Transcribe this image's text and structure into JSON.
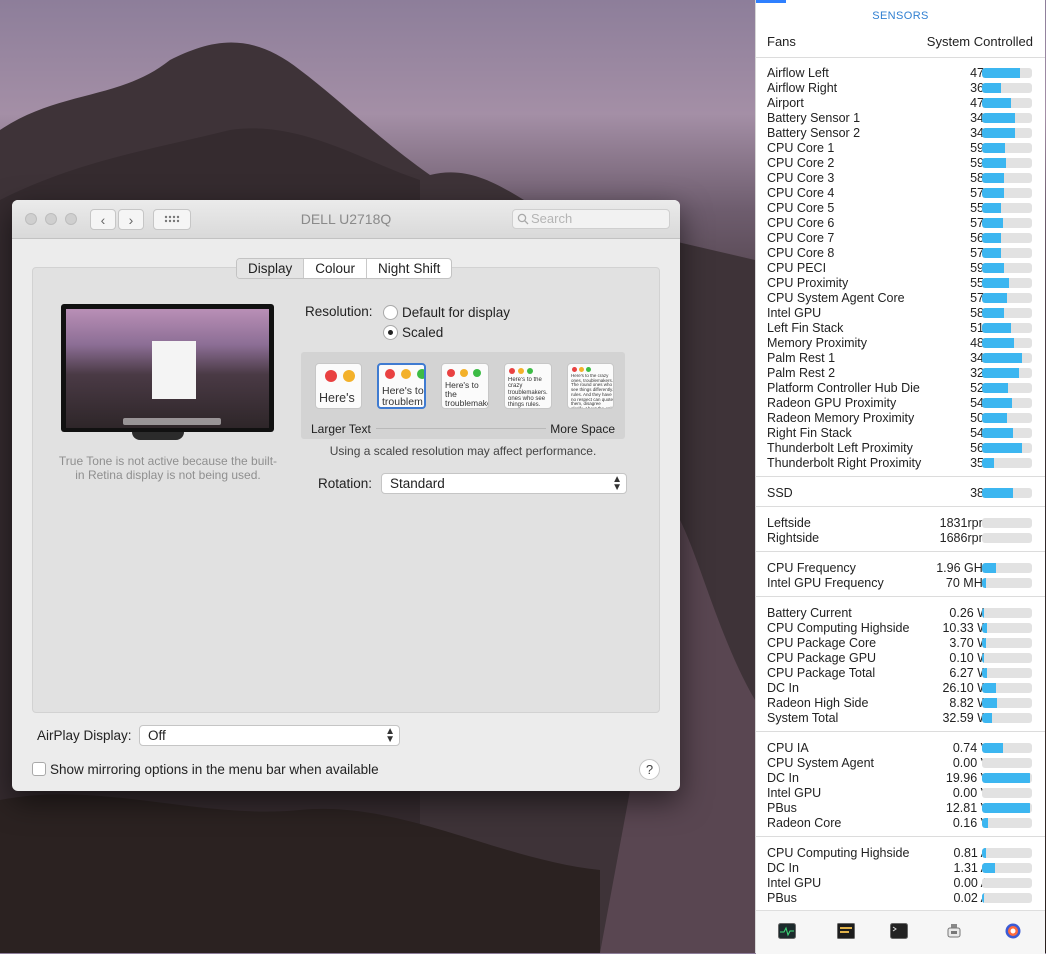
{
  "window": {
    "title": "DELL U2718Q",
    "search_placeholder": "Search",
    "tabs": [
      "Display",
      "Colour",
      "Night Shift"
    ],
    "true_tone_note": "True Tone is not active because the built-in Retina display is not being used.",
    "resolution_label": "Resolution:",
    "resolution_options": [
      "Default for display",
      "Scaled"
    ],
    "resolution_selected": "Scaled",
    "thumb_texts": [
      "Here's",
      "Here's to troublem",
      "Here's to the troublemakers. ones who see",
      "Here's to the crazy troublemakers. ones who see things rules. And they",
      "Here's to the crazy ones, troublemakers. The round ones who see things differently. rules. And they have no respect can quote them, disagree glorify. About the only thing because they change things."
    ],
    "scale_left_label": "Larger Text",
    "scale_right_label": "More Space",
    "perf_note": "Using a scaled resolution may affect performance.",
    "rotation_label": "Rotation:",
    "rotation_value": "Standard",
    "airplay_label": "AirPlay Display:",
    "airplay_value": "Off",
    "mirroring_label": "Show mirroring options in the menu bar when available",
    "help_label": "?"
  },
  "sensors": {
    "title": "SENSORS",
    "fans_label": "Fans",
    "fans_value": "System Controlled",
    "temperatures": [
      {
        "name": "Airflow Left",
        "value": "47°",
        "level": 0.75
      },
      {
        "name": "Airflow Right",
        "value": "36°",
        "level": 0.38
      },
      {
        "name": "Airport",
        "value": "47°",
        "level": 0.58
      },
      {
        "name": "Battery Sensor 1",
        "value": "34°",
        "level": 0.66
      },
      {
        "name": "Battery Sensor 2",
        "value": "34°",
        "level": 0.66
      },
      {
        "name": "CPU Core 1",
        "value": "59°",
        "level": 0.46
      },
      {
        "name": "CPU Core 2",
        "value": "59°",
        "level": 0.48
      },
      {
        "name": "CPU Core 3",
        "value": "58°",
        "level": 0.44
      },
      {
        "name": "CPU Core 4",
        "value": "57°",
        "level": 0.44
      },
      {
        "name": "CPU Core 5",
        "value": "55°",
        "level": 0.38
      },
      {
        "name": "CPU Core 6",
        "value": "57°",
        "level": 0.42
      },
      {
        "name": "CPU Core 7",
        "value": "56°",
        "level": 0.38
      },
      {
        "name": "CPU Core 8",
        "value": "57°",
        "level": 0.38
      },
      {
        "name": "CPU PECI",
        "value": "59°",
        "level": 0.44
      },
      {
        "name": "CPU Proximity",
        "value": "55°",
        "level": 0.54
      },
      {
        "name": "CPU System Agent Core",
        "value": "57°",
        "level": 0.5
      },
      {
        "name": "Intel GPU",
        "value": "58°",
        "level": 0.44
      },
      {
        "name": "Left Fin Stack",
        "value": "51°",
        "level": 0.58
      },
      {
        "name": "Memory Proximity",
        "value": "48°",
        "level": 0.64
      },
      {
        "name": "Palm Rest 1",
        "value": "34°",
        "level": 0.8
      },
      {
        "name": "Palm Rest 2",
        "value": "32°",
        "level": 0.74
      },
      {
        "name": "Platform Controller Hub Die",
        "value": "52°",
        "level": 0.52
      },
      {
        "name": "Radeon GPU Proximity",
        "value": "54°",
        "level": 0.6
      },
      {
        "name": "Radeon Memory Proximity",
        "value": "50°",
        "level": 0.5
      },
      {
        "name": "Right Fin Stack",
        "value": "54°",
        "level": 0.62
      },
      {
        "name": "Thunderbolt Left Proximity",
        "value": "56°",
        "level": 0.8
      },
      {
        "name": "Thunderbolt Right Proximity",
        "value": "35°",
        "level": 0.24
      }
    ],
    "ssd": [
      {
        "name": "SSD",
        "value": "38°",
        "level": 0.62
      }
    ],
    "fans": [
      {
        "name": "Leftside",
        "value": "1831rpm",
        "level": 0.0
      },
      {
        "name": "Rightside",
        "value": "1686rpm",
        "level": 0.0
      }
    ],
    "frequencies": [
      {
        "name": "CPU Frequency",
        "value": "1.96 GHz",
        "level": 0.28
      },
      {
        "name": "Intel GPU Frequency",
        "value": "70 MHz",
        "level": 0.08
      }
    ],
    "power": [
      {
        "name": "Battery Current",
        "value": "0.26 W",
        "level": 0.03
      },
      {
        "name": "CPU Computing Highside",
        "value": "10.33 W",
        "level": 0.1
      },
      {
        "name": "CPU Package Core",
        "value": "3.70 W",
        "level": 0.08
      },
      {
        "name": "CPU Package GPU",
        "value": "0.10 W",
        "level": 0.03
      },
      {
        "name": "CPU Package Total",
        "value": "6.27 W",
        "level": 0.1
      },
      {
        "name": "DC In",
        "value": "26.10 W",
        "level": 0.28
      },
      {
        "name": "Radeon High Side",
        "value": "8.82 W",
        "level": 0.3
      },
      {
        "name": "System Total",
        "value": "32.59 W",
        "level": 0.2
      }
    ],
    "voltages": [
      {
        "name": "CPU IA",
        "value": "0.74 V",
        "level": 0.42
      },
      {
        "name": "CPU System Agent",
        "value": "0.00 V",
        "level": 0.0
      },
      {
        "name": "DC In",
        "value": "19.96 V",
        "level": 0.96
      },
      {
        "name": "Intel GPU",
        "value": "0.00 V",
        "level": 0.0
      },
      {
        "name": "PBus",
        "value": "12.81 V",
        "level": 0.96
      },
      {
        "name": "Radeon Core",
        "value": "0.16 V",
        "level": 0.12
      }
    ],
    "currents": [
      {
        "name": "CPU Computing Highside",
        "value": "0.81 A",
        "level": 0.08
      },
      {
        "name": "DC In",
        "value": "1.31 A",
        "level": 0.26
      },
      {
        "name": "Intel GPU",
        "value": "0.00 A",
        "level": 0.0
      },
      {
        "name": "PBus",
        "value": "0.02 A",
        "level": 0.03
      }
    ],
    "bar_color": "#3cb6f0"
  }
}
